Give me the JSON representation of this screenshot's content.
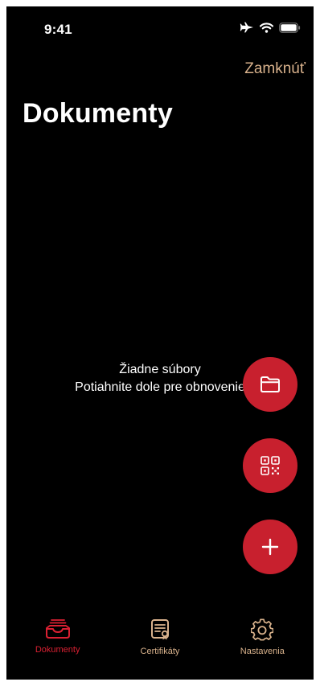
{
  "colors": {
    "accent": "#C8202E",
    "lock_text": "#D9B28C",
    "tab_active": "#D92032",
    "tab_inactive": "#D9B28C"
  },
  "status_bar": {
    "time": "9:41",
    "icons": [
      "airplane-icon",
      "wifi-icon",
      "battery-icon"
    ]
  },
  "header": {
    "lock_label": "Zamknúť",
    "title": "Dokumenty"
  },
  "empty_state": {
    "line1": "Žiadne súbory",
    "line2": "Potiahnite dole pre obnovenie"
  },
  "fab_buttons": [
    {
      "name": "open-folder-button",
      "icon": "folder-icon"
    },
    {
      "name": "scan-qr-button",
      "icon": "qr-code-icon"
    },
    {
      "name": "add-button",
      "icon": "plus-icon"
    }
  ],
  "tabs": [
    {
      "label": "Dokumenty",
      "icon": "tray-icon",
      "active": true
    },
    {
      "label": "Certifikáty",
      "icon": "certificate-icon",
      "active": false
    },
    {
      "label": "Nastavenia",
      "icon": "gear-icon",
      "active": false
    }
  ]
}
